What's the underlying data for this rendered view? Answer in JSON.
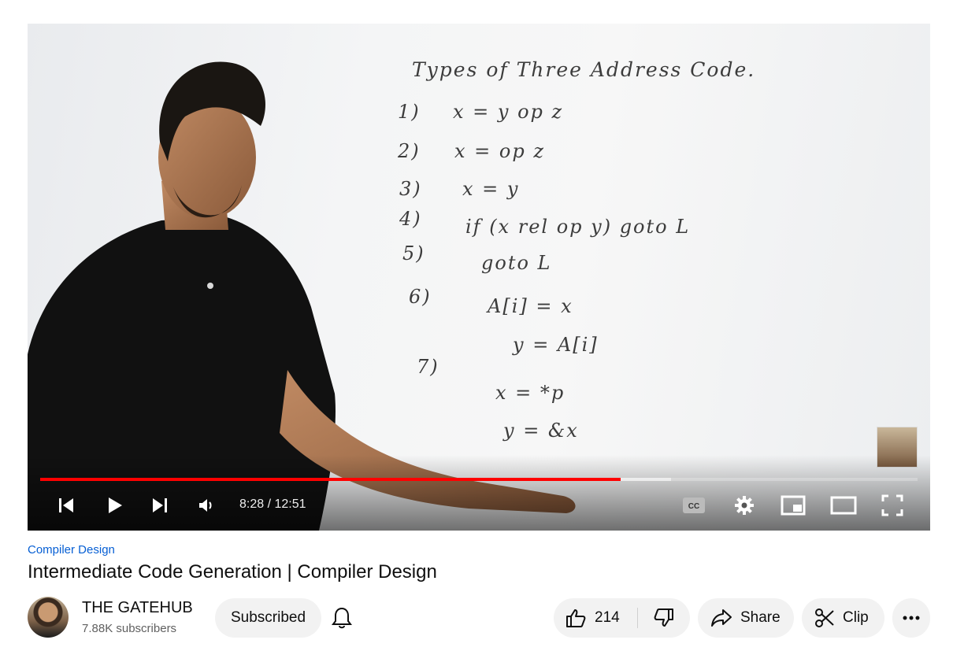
{
  "player": {
    "board": {
      "title": "Types of Three Address Code.",
      "lines": [
        {
          "num": "1)",
          "expr": "x = y op z"
        },
        {
          "num": "2)",
          "expr": "x = op z"
        },
        {
          "num": "3)",
          "expr": "x = y"
        },
        {
          "num": "4)",
          "expr": "if (x rel op y) goto L"
        },
        {
          "num": "5)",
          "expr": "goto L"
        },
        {
          "num": "6)",
          "expr": "A[i] = x"
        },
        {
          "num": "",
          "expr": "y = A[i]"
        },
        {
          "num": "7)",
          "expr": "x = *p"
        },
        {
          "num": "",
          "expr": "y = &x"
        }
      ]
    },
    "time_display": "8:28 / 12:51",
    "progress": {
      "played_fraction": 0.6617,
      "buffered_fraction": 0.7186
    },
    "controls": {
      "left": [
        "previous-icon",
        "play-icon",
        "next-icon",
        "volume-icon"
      ],
      "right": [
        "captions-icon",
        "settings-icon",
        "miniplayer-icon",
        "theater-icon",
        "fullscreen-icon"
      ]
    },
    "colors": {
      "progress_played": "#ff0000"
    }
  },
  "video": {
    "playlist": "Compiler Design",
    "title": "Intermediate Code Generation | Compiler Design"
  },
  "channel": {
    "name": "THE GATEHUB",
    "subscribers": "7.88K subscribers",
    "subscribe_label": "Subscribed"
  },
  "actions": {
    "likes": "214",
    "share_label": "Share",
    "clip_label": "Clip"
  }
}
